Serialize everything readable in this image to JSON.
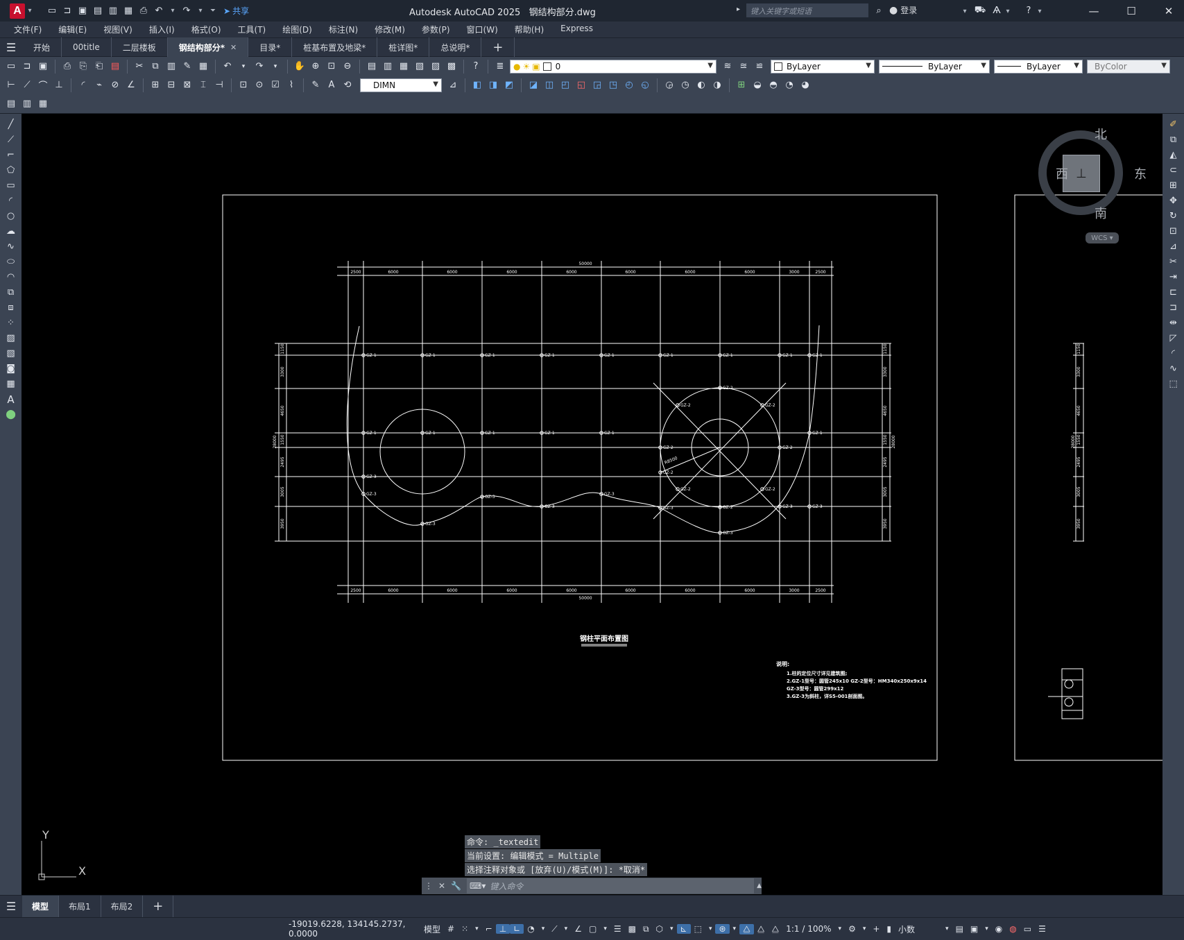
{
  "app": {
    "title": "Autodesk AutoCAD 2025",
    "filename": "钢结构部分.dwg",
    "search_placeholder": "键入关键字或短语",
    "login": "登录",
    "share": "共享"
  },
  "menu": [
    "文件(F)",
    "编辑(E)",
    "视图(V)",
    "插入(I)",
    "格式(O)",
    "工具(T)",
    "绘图(D)",
    "标注(N)",
    "修改(M)",
    "参数(P)",
    "窗口(W)",
    "帮助(H)",
    "Express"
  ],
  "tabs": [
    "开始",
    "00title",
    "二层楼板",
    "钢结构部分*",
    "目录*",
    "桩基布置及地梁*",
    "桩详图*",
    "总说明*"
  ],
  "active_tab_index": 3,
  "toolbar": {
    "layer_value": "0",
    "color_value": "ByLayer",
    "linetype_value": "ByLayer",
    "lineweight_value": "ByLayer",
    "plotstyle_value": "ByColor",
    "dimstyle_value": "DIMN"
  },
  "viewcube": {
    "north": "北",
    "south": "南",
    "east": "东",
    "west": "西",
    "ucs": "WCS"
  },
  "ucs_axes": {
    "x": "X",
    "y": "Y"
  },
  "drawing": {
    "title": "钢柱平面布置图",
    "notes_title": "说明:",
    "notes": [
      "1.柱的定位尺寸详见建筑图;",
      "2.GZ-1型号：圆管245x10   GZ-2型号：HM340x250x9x14",
      "   GZ-3型号：圆管299x12",
      "3.GZ-3为斜柱，详S5-001剖面图。"
    ],
    "top_overall": "50000",
    "bottom_overall": "50000",
    "spans": [
      "2500",
      "6000",
      "6000",
      "6000",
      "6000",
      "6000",
      "6000",
      "6000",
      "3000",
      "2500"
    ],
    "left_overall": "28000",
    "right_overall": "28000",
    "left_dims": [
      "1150",
      "3300",
      "4650",
      "1550",
      "2495",
      "3005",
      "3950"
    ],
    "column_labels": [
      "GZ-1",
      "GZ-2",
      "GZ-3"
    ],
    "radius_label": "R8500"
  },
  "command": {
    "history": [
      "命令: _textedit",
      "当前设置: 编辑模式 = Multiple",
      "选择注释对象或 [放弃(U)/模式(M)]: *取消*"
    ],
    "placeholder": "键入命令"
  },
  "layout_tabs": [
    "模型",
    "布局1",
    "布局2"
  ],
  "status": {
    "coords": "-19019.6228, 134145.2737, 0.0000",
    "model": "模型",
    "scale": "1:1 / 100%",
    "units": "小数"
  },
  "colors": {
    "accent": "#3d6fa8",
    "canvas": "#000000",
    "app_red": "#c8102e"
  }
}
